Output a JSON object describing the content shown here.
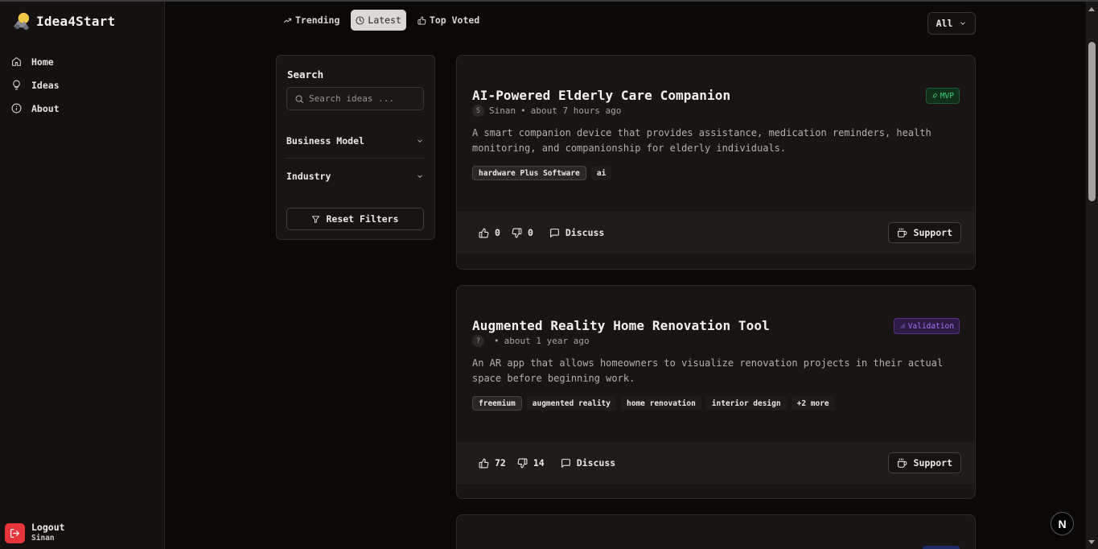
{
  "app": {
    "name": "Idea4Start"
  },
  "nav": [
    {
      "label": "Home",
      "icon": "home-icon"
    },
    {
      "label": "Ideas",
      "icon": "lightbulb-icon"
    },
    {
      "label": "About",
      "icon": "info-icon"
    }
  ],
  "user": {
    "logout_label": "Logout",
    "name": "Sinan"
  },
  "tabs": [
    {
      "label": "Trending",
      "icon": "trending-icon",
      "active": false
    },
    {
      "label": "Latest",
      "icon": "clock-icon",
      "active": true
    },
    {
      "label": "Top Voted",
      "icon": "thumbs-up-icon",
      "active": false
    }
  ],
  "stage_filter": {
    "value": "All"
  },
  "filters": {
    "title": "Search",
    "search_placeholder": "Search ideas ...",
    "business_model_label": "Business Model",
    "industry_label": "Industry",
    "reset_label": "Reset Filters"
  },
  "ideas": [
    {
      "title": "AI-Powered Elderly Care Companion",
      "stage": "MVP",
      "author_initial": "S",
      "author": "Sinan",
      "time": "about 7 hours ago",
      "description": "A smart companion device that provides assistance, medication reminders, health monitoring, and companionship for elderly individuals.",
      "tags": [
        "hardware Plus Software",
        "ai"
      ],
      "upvotes": "0",
      "downvotes": "0",
      "discuss_label": "Discuss",
      "support_label": "Support"
    },
    {
      "title": "Augmented Reality Home Renovation Tool",
      "stage": "Validation",
      "author_initial": "?",
      "author": "",
      "time": "about 1 year ago",
      "description": "An AR app that allows homeowners to visualize renovation projects in their actual space before beginning work.",
      "tags": [
        "freemium",
        "augmented reality",
        "home renovation",
        "interior design",
        "+2 more"
      ],
      "upvotes": "72",
      "downvotes": "14",
      "discuss_label": "Discuss",
      "support_label": "Support"
    }
  ],
  "colors": {
    "accent_mvp": "#3bd16f",
    "accent_validation": "#a874f0",
    "logout": "#e5353b"
  }
}
